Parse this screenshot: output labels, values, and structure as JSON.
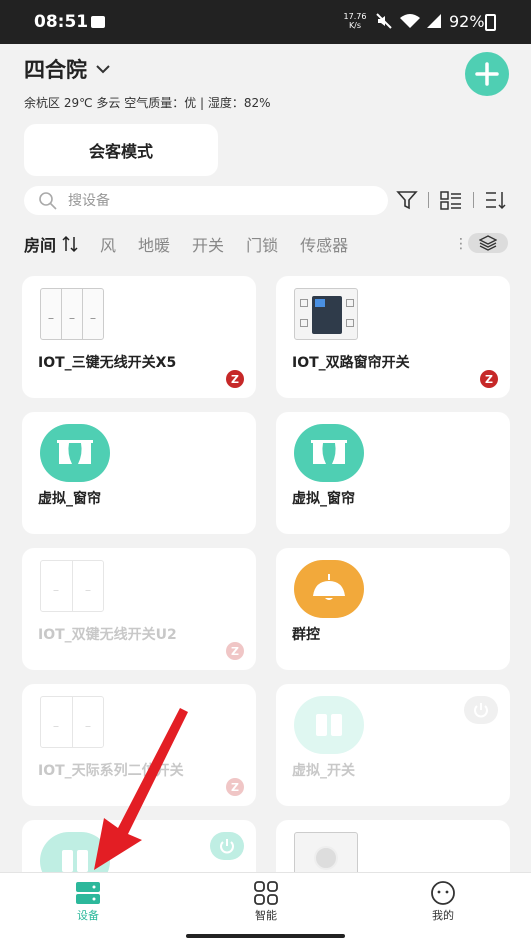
{
  "status_bar": {
    "time": "08:51",
    "net_speed_value": "17.76",
    "net_speed_unit": "K/s",
    "battery": "92%"
  },
  "header": {
    "home_name": "四合院",
    "weather": "余杭区 29℃ 多云 空气质量：优 | 湿度：82%"
  },
  "guest_mode": {
    "label": "会客模式"
  },
  "search": {
    "placeholder": "搜设备"
  },
  "tabs": [
    "房间",
    "风",
    "地暖",
    "开关",
    "门锁",
    "传感器"
  ],
  "devices": [
    {
      "name": "IOT_三键无线开关X5",
      "badge": "Z"
    },
    {
      "name": "IOT_双路窗帘开关",
      "badge": "Z"
    },
    {
      "name": "虚拟_窗帘"
    },
    {
      "name": "虚拟_窗帘"
    },
    {
      "name": "IOT_双键无线开关U2",
      "badge": "Z"
    },
    {
      "name": "群控"
    },
    {
      "name": "IOT_天际系列二位开关",
      "badge": "Z"
    },
    {
      "name": "虚拟_开关"
    }
  ],
  "nav": {
    "devices": "设备",
    "smart": "智能",
    "mine": "我的"
  },
  "colors": {
    "accent": "#4fcfb3",
    "zigbee": "#c62828",
    "group_control": "#f2a93b",
    "arrow": "#e31e24"
  }
}
